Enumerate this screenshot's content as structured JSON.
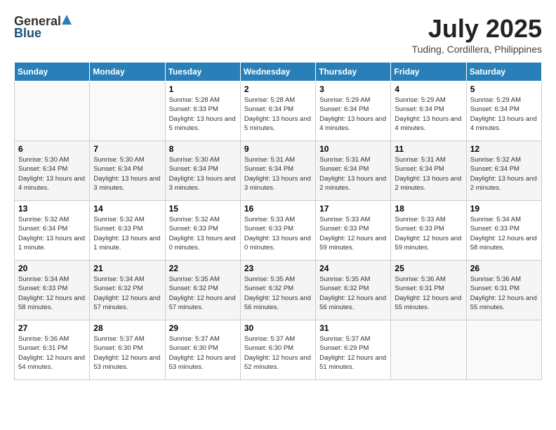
{
  "logo": {
    "general": "General",
    "blue": "Blue"
  },
  "title": {
    "month": "July 2025",
    "location": "Tuding, Cordillera, Philippines"
  },
  "headers": [
    "Sunday",
    "Monday",
    "Tuesday",
    "Wednesday",
    "Thursday",
    "Friday",
    "Saturday"
  ],
  "weeks": [
    [
      {
        "day": "",
        "info": ""
      },
      {
        "day": "",
        "info": ""
      },
      {
        "day": "1",
        "info": "Sunrise: 5:28 AM\nSunset: 6:33 PM\nDaylight: 13 hours and 5 minutes."
      },
      {
        "day": "2",
        "info": "Sunrise: 5:28 AM\nSunset: 6:34 PM\nDaylight: 13 hours and 5 minutes."
      },
      {
        "day": "3",
        "info": "Sunrise: 5:29 AM\nSunset: 6:34 PM\nDaylight: 13 hours and 4 minutes."
      },
      {
        "day": "4",
        "info": "Sunrise: 5:29 AM\nSunset: 6:34 PM\nDaylight: 13 hours and 4 minutes."
      },
      {
        "day": "5",
        "info": "Sunrise: 5:29 AM\nSunset: 6:34 PM\nDaylight: 13 hours and 4 minutes."
      }
    ],
    [
      {
        "day": "6",
        "info": "Sunrise: 5:30 AM\nSunset: 6:34 PM\nDaylight: 13 hours and 4 minutes."
      },
      {
        "day": "7",
        "info": "Sunrise: 5:30 AM\nSunset: 6:34 PM\nDaylight: 13 hours and 3 minutes."
      },
      {
        "day": "8",
        "info": "Sunrise: 5:30 AM\nSunset: 6:34 PM\nDaylight: 13 hours and 3 minutes."
      },
      {
        "day": "9",
        "info": "Sunrise: 5:31 AM\nSunset: 6:34 PM\nDaylight: 13 hours and 3 minutes."
      },
      {
        "day": "10",
        "info": "Sunrise: 5:31 AM\nSunset: 6:34 PM\nDaylight: 13 hours and 2 minutes."
      },
      {
        "day": "11",
        "info": "Sunrise: 5:31 AM\nSunset: 6:34 PM\nDaylight: 13 hours and 2 minutes."
      },
      {
        "day": "12",
        "info": "Sunrise: 5:32 AM\nSunset: 6:34 PM\nDaylight: 13 hours and 2 minutes."
      }
    ],
    [
      {
        "day": "13",
        "info": "Sunrise: 5:32 AM\nSunset: 6:34 PM\nDaylight: 13 hours and 1 minute."
      },
      {
        "day": "14",
        "info": "Sunrise: 5:32 AM\nSunset: 6:33 PM\nDaylight: 13 hours and 1 minute."
      },
      {
        "day": "15",
        "info": "Sunrise: 5:32 AM\nSunset: 6:33 PM\nDaylight: 13 hours and 0 minutes."
      },
      {
        "day": "16",
        "info": "Sunrise: 5:33 AM\nSunset: 6:33 PM\nDaylight: 13 hours and 0 minutes."
      },
      {
        "day": "17",
        "info": "Sunrise: 5:33 AM\nSunset: 6:33 PM\nDaylight: 12 hours and 59 minutes."
      },
      {
        "day": "18",
        "info": "Sunrise: 5:33 AM\nSunset: 6:33 PM\nDaylight: 12 hours and 59 minutes."
      },
      {
        "day": "19",
        "info": "Sunrise: 5:34 AM\nSunset: 6:33 PM\nDaylight: 12 hours and 58 minutes."
      }
    ],
    [
      {
        "day": "20",
        "info": "Sunrise: 5:34 AM\nSunset: 6:33 PM\nDaylight: 12 hours and 58 minutes."
      },
      {
        "day": "21",
        "info": "Sunrise: 5:34 AM\nSunset: 6:32 PM\nDaylight: 12 hours and 57 minutes."
      },
      {
        "day": "22",
        "info": "Sunrise: 5:35 AM\nSunset: 6:32 PM\nDaylight: 12 hours and 57 minutes."
      },
      {
        "day": "23",
        "info": "Sunrise: 5:35 AM\nSunset: 6:32 PM\nDaylight: 12 hours and 56 minutes."
      },
      {
        "day": "24",
        "info": "Sunrise: 5:35 AM\nSunset: 6:32 PM\nDaylight: 12 hours and 56 minutes."
      },
      {
        "day": "25",
        "info": "Sunrise: 5:36 AM\nSunset: 6:31 PM\nDaylight: 12 hours and 55 minutes."
      },
      {
        "day": "26",
        "info": "Sunrise: 5:36 AM\nSunset: 6:31 PM\nDaylight: 12 hours and 55 minutes."
      }
    ],
    [
      {
        "day": "27",
        "info": "Sunrise: 5:36 AM\nSunset: 6:31 PM\nDaylight: 12 hours and 54 minutes."
      },
      {
        "day": "28",
        "info": "Sunrise: 5:37 AM\nSunset: 6:30 PM\nDaylight: 12 hours and 53 minutes."
      },
      {
        "day": "29",
        "info": "Sunrise: 5:37 AM\nSunset: 6:30 PM\nDaylight: 12 hours and 53 minutes."
      },
      {
        "day": "30",
        "info": "Sunrise: 5:37 AM\nSunset: 6:30 PM\nDaylight: 12 hours and 52 minutes."
      },
      {
        "day": "31",
        "info": "Sunrise: 5:37 AM\nSunset: 6:29 PM\nDaylight: 12 hours and 51 minutes."
      },
      {
        "day": "",
        "info": ""
      },
      {
        "day": "",
        "info": ""
      }
    ]
  ]
}
